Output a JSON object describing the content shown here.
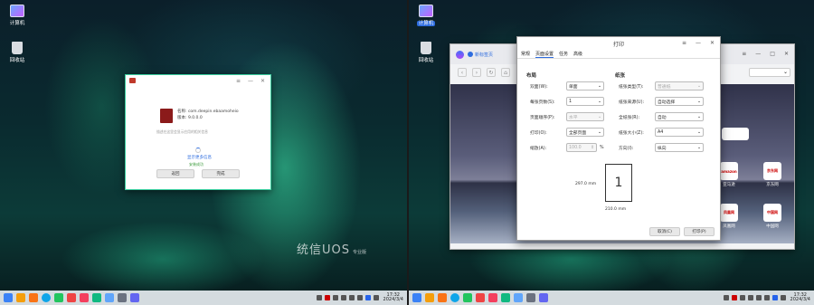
{
  "left": {
    "desktop_icons": [
      {
        "label": "计算机",
        "icon": "computer-icon"
      },
      {
        "label": "回收站",
        "icon": "trash-icon"
      }
    ],
    "installer": {
      "name_line": "名称: com.deepin.ebaamoheio",
      "version_line": "版本: 9.0.0.0",
      "desc": "描述在这里会显示应用的相关信息",
      "link": "显示更多信息",
      "status": "安装成功",
      "back": "返回",
      "done": "完成"
    },
    "watermark": {
      "brand": "统信UOS",
      "edition": "专业版"
    },
    "clock": {
      "time": "17:32",
      "date": "2024/3/4"
    }
  },
  "right": {
    "desktop_icons": [
      {
        "label": "计算机",
        "icon": "computer-icon"
      },
      {
        "label": "回收站",
        "icon": "trash-icon"
      }
    ],
    "browser": {
      "tab_title": "新标签页",
      "url_value": "⌄",
      "window_controls": [
        "≡",
        "—",
        "□",
        "✕"
      ],
      "tiles": [
        {
          "label": "亚马逊",
          "logo": "amazon"
        },
        {
          "label": "京东网",
          "logo": "京东网"
        },
        {
          "label": "凤凰网",
          "logo": "凤凰网"
        },
        {
          "label": "中国网",
          "logo": "中国网"
        }
      ]
    },
    "print": {
      "title": "打印",
      "tabs": [
        "常规",
        "页面设置",
        "任务",
        "高级"
      ],
      "layout_title": "布局",
      "paper_title": "纸张",
      "rows_left": [
        {
          "label": "双面(W):",
          "value": "单面"
        },
        {
          "label": "每张页数(S):",
          "value": "1"
        },
        {
          "label": "页面顺序(P):",
          "value": "水平"
        },
        {
          "label": "打印(O):",
          "value": "全部页面"
        },
        {
          "label": "缩放(A):",
          "value": "100.0",
          "unit": "%"
        }
      ],
      "rows_right": [
        {
          "label": "纸张类型(T):",
          "value": "普通纸"
        },
        {
          "label": "纸张来源(U):",
          "value": "自动选择"
        },
        {
          "label": "全纸张(R):",
          "value": "自动"
        },
        {
          "label": "纸张大小(Z):",
          "value": "A4"
        },
        {
          "label": "方向(I):",
          "value": "纵向"
        }
      ],
      "preview_number": "1",
      "preview_height": "297.0 mm",
      "preview_width": "210.0 mm",
      "cancel": "取消(C)",
      "print": "打印(P)"
    },
    "clock": {
      "time": "17:32",
      "date": "2024/3/4"
    }
  },
  "taskbar_icons": [
    "launcher",
    "multitask",
    "files",
    "browser",
    "store",
    "music",
    "video",
    "photos",
    "docs",
    "terminal",
    "settings"
  ]
}
